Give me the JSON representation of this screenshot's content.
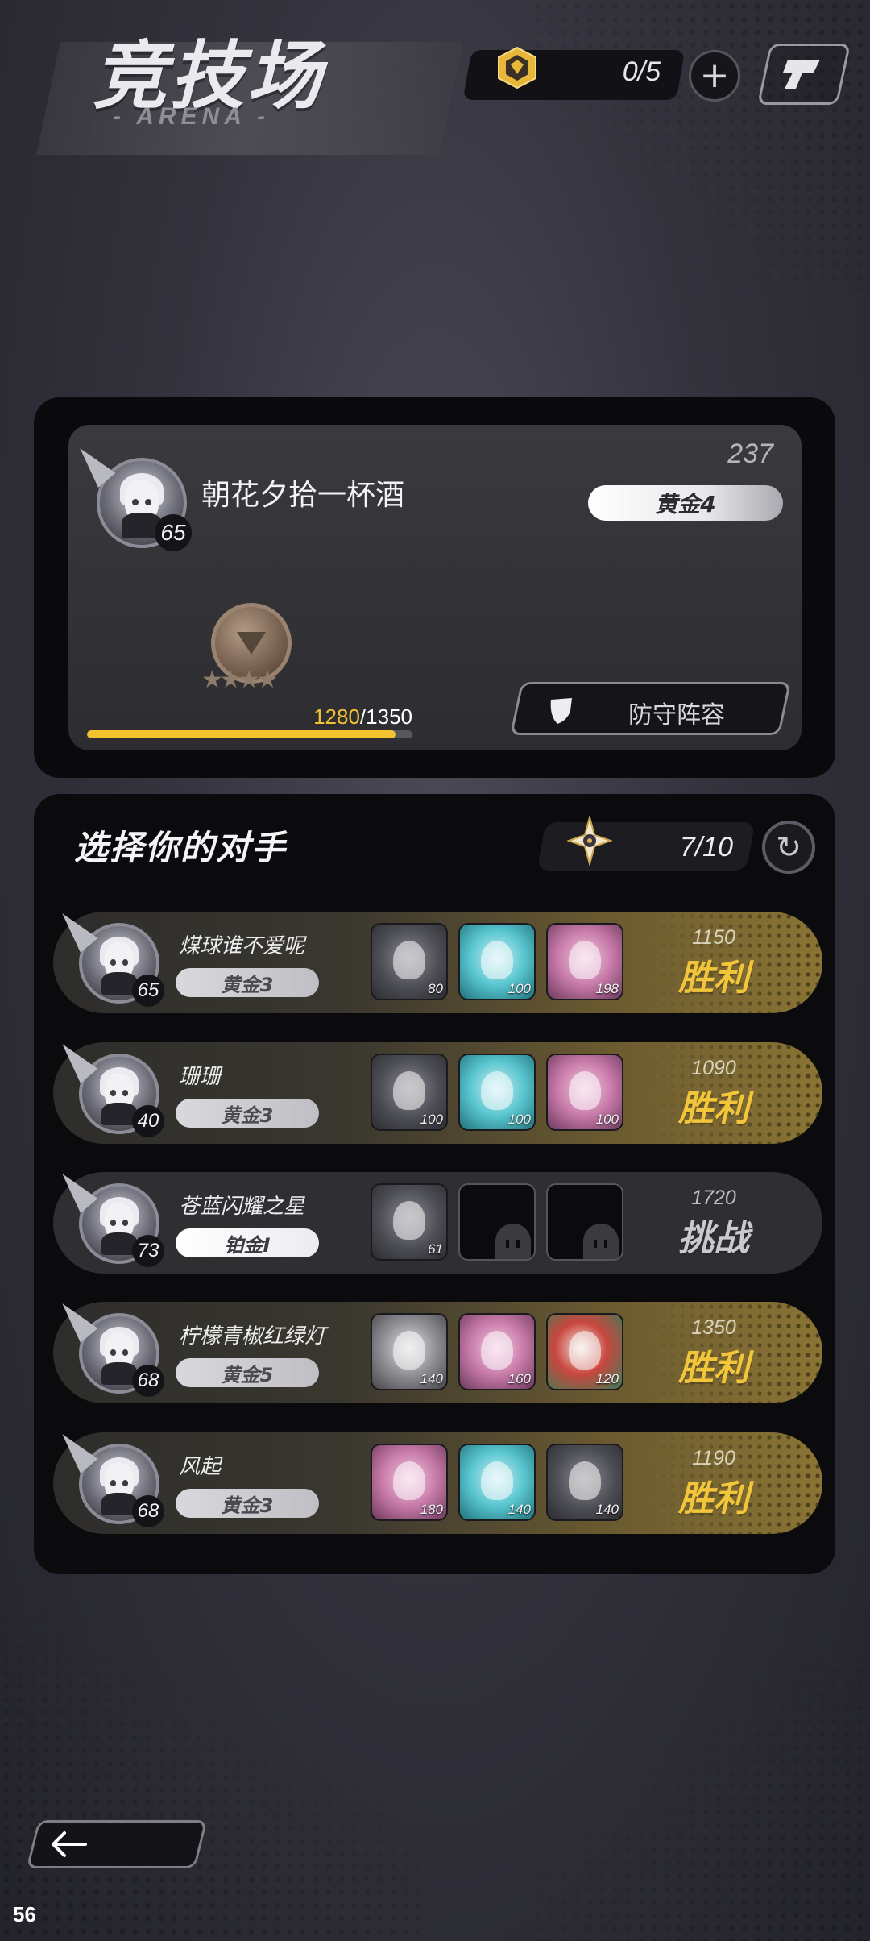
{
  "header": {
    "title": "竞技场",
    "subtitle": "- ARENA -",
    "currency_value": "0/5",
    "plus_label": "+"
  },
  "player": {
    "name": "朝花夕拾一杯酒",
    "level": "65",
    "score": "237",
    "rank": "黄金4",
    "xp_current": "1280",
    "xp_max": "/1350",
    "xp_progress": 0.948,
    "defense_label": "防守阵容",
    "stars": "★★★★"
  },
  "opponents_panel": {
    "title": "选择你的对手",
    "tickets": "7/10"
  },
  "opponents": [
    {
      "name": "煤球谁不爱呢",
      "level": "65",
      "rank": "黄金3",
      "power": "1150",
      "status": "胜利",
      "team": [
        {
          "lvl": "80",
          "color": "dark"
        },
        {
          "lvl": "100",
          "color": "cyan"
        },
        {
          "lvl": "198",
          "color": "pink"
        }
      ]
    },
    {
      "name": "珊珊",
      "level": "40",
      "rank": "黄金3",
      "power": "1090",
      "status": "胜利",
      "team": [
        {
          "lvl": "100",
          "color": "dark"
        },
        {
          "lvl": "100",
          "color": "cyan"
        },
        {
          "lvl": "100",
          "color": "pink"
        }
      ]
    },
    {
      "name": "苍蓝闪耀之星",
      "level": "73",
      "rank": "铂金I",
      "power": "1720",
      "status": "挑战",
      "team": [
        {
          "lvl": "61",
          "color": "dark"
        },
        {
          "lvl": "",
          "color": "empty"
        },
        {
          "lvl": "",
          "color": "empty"
        }
      ]
    },
    {
      "name": "柠檬青椒红绿灯",
      "level": "68",
      "rank": "黄金5",
      "power": "1350",
      "status": "胜利",
      "team": [
        {
          "lvl": "140",
          "color": "grey"
        },
        {
          "lvl": "160",
          "color": "pink"
        },
        {
          "lvl": "120",
          "color": "red"
        }
      ]
    },
    {
      "name": "风起",
      "level": "68",
      "rank": "黄金3",
      "power": "1190",
      "status": "胜利",
      "team": [
        {
          "lvl": "180",
          "color": "pink"
        },
        {
          "lvl": "140",
          "color": "cyan"
        },
        {
          "lvl": "140",
          "color": "dark"
        }
      ]
    }
  ],
  "footer": {
    "fps": "56"
  },
  "colors": {
    "gold": "#f2c53a",
    "xp_fill": "#f4c430",
    "panel": "#0a0a0d"
  },
  "icons": [
    "currency-hex-icon",
    "plus-icon",
    "share-icon",
    "shield-icon",
    "ticket-star-icon",
    "refresh-icon",
    "back-arrow-icon"
  ]
}
